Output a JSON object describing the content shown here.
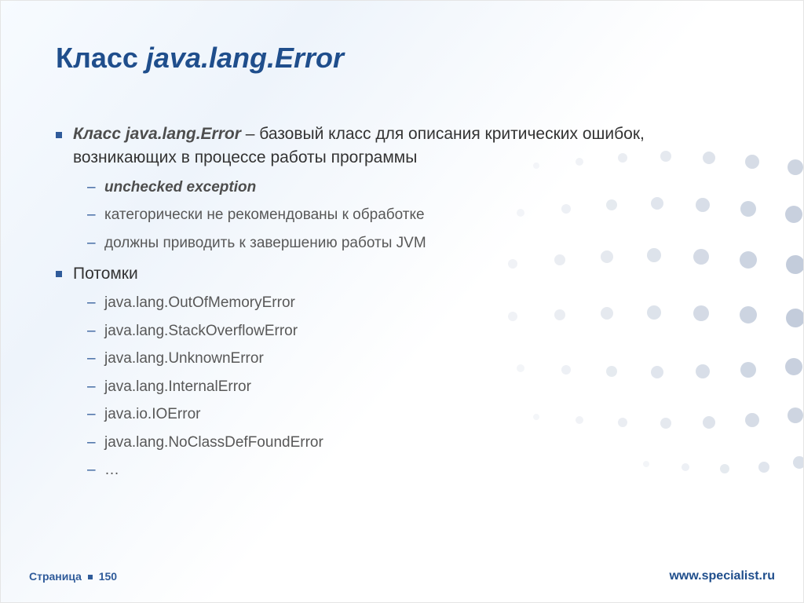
{
  "title_prefix": "Класс ",
  "title_italic": "java.lang.Error",
  "bullets": {
    "b1_strong": "Класс java.lang.Error",
    "b1_rest": " – базовый класс для описания критических ошибок, возникающих в процессе работы программы",
    "b1_sub": [
      "unchecked exception",
      "категорически не рекомендованы к обработке",
      "должны приводить к завершению работы JVM"
    ],
    "b2": "Потомки",
    "b2_sub": [
      "java.lang.OutOfMemoryError",
      "java.lang.StackOverflowError",
      "java.lang.UnknownError",
      "java.lang.InternalError",
      "java.io.IOError",
      "java.lang.NoClassDefFoundError",
      "…"
    ]
  },
  "footer": {
    "page_word": "Страница",
    "page_number": "150",
    "url": "www.specialist.ru"
  }
}
